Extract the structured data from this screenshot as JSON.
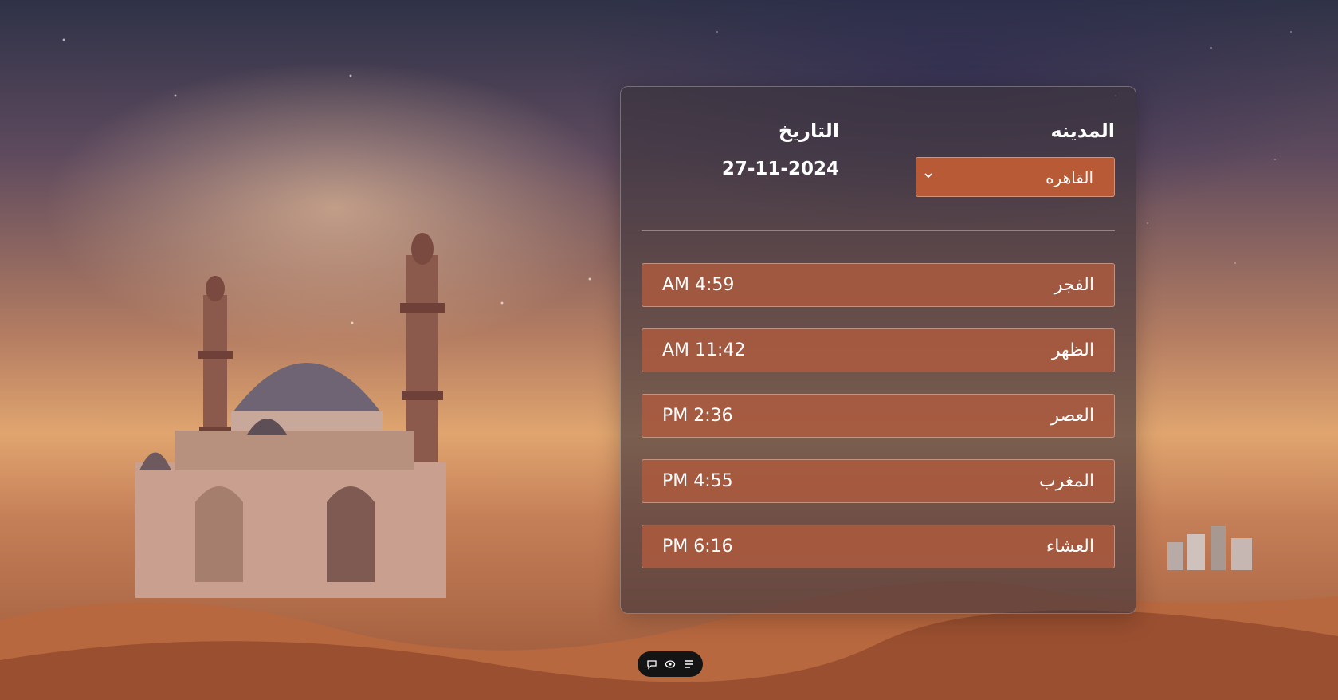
{
  "header": {
    "city_label": "المدينه",
    "date_label": "التاريخ",
    "city_select": {
      "selected": "القاهره"
    },
    "date_value": "27-11-2024"
  },
  "prayers": [
    {
      "name": "الفجر",
      "time": "AM 4:59"
    },
    {
      "name": "الظهر",
      "time": "AM 11:42"
    },
    {
      "name": "العصر",
      "time": "PM 2:36"
    },
    {
      "name": "المغرب",
      "time": "PM 4:55"
    },
    {
      "name": "العشاء",
      "time": "PM 6:16"
    }
  ],
  "toolbar": {
    "icons": [
      "comment-icon",
      "eye-icon",
      "list-icon"
    ]
  },
  "colors": {
    "select_bg": "#b85a36",
    "row_bg": "#b05c3e",
    "panel_bg": "#3c343c",
    "toolbar_bg": "#141414"
  }
}
